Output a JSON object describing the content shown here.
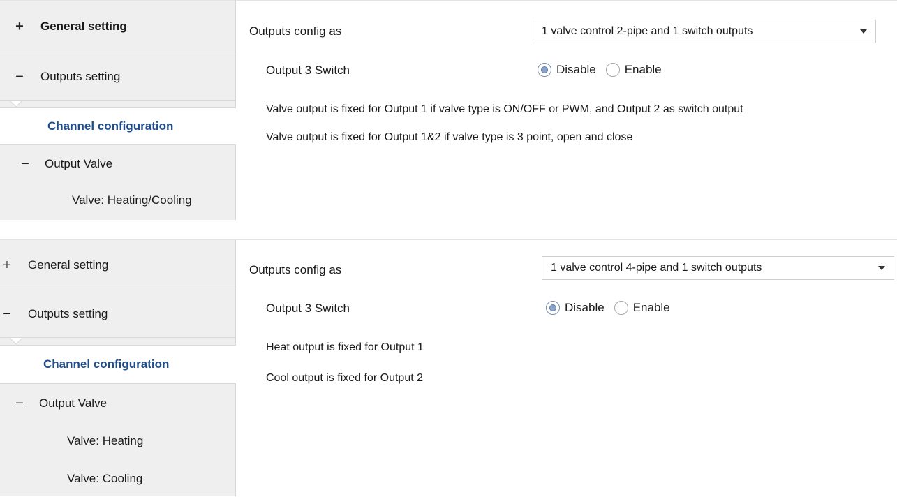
{
  "panel1": {
    "sidebar": {
      "general_sign": "+",
      "general_label": "General setting",
      "outputs_sign": "−",
      "outputs_label": "Outputs setting",
      "channel_label": "Channel configuration",
      "valve_sign": "−",
      "valve_label": "Output Valve",
      "sub_items": [
        "Valve: Heating/Cooling"
      ]
    },
    "main": {
      "config_label": "Outputs config as",
      "config_value": "1 valve control 2-pipe and 1 switch outputs",
      "switch_label": "Output 3 Switch",
      "radio_disable": "Disable",
      "radio_enable": "Enable",
      "selected": "Disable",
      "notes": [
        "Valve output is fixed for Output 1 if  valve type is ON/OFF or PWM, and Output 2 as switch output",
        "Valve output is fixed for Output 1&2 if  valve type is 3 point, open and close"
      ]
    }
  },
  "panel2": {
    "sidebar": {
      "general_sign": "+",
      "general_label": "General setting",
      "outputs_sign": "−",
      "outputs_label": "Outputs setting",
      "channel_label": "Channel configuration",
      "valve_sign": "−",
      "valve_label": "Output Valve",
      "sub_items": [
        "Valve: Heating",
        "Valve: Cooling"
      ]
    },
    "main": {
      "config_label": "Outputs config as",
      "config_value": "1 valve control 4-pipe and 1 switch outputs",
      "switch_label": "Output 3 Switch",
      "radio_disable": "Disable",
      "radio_enable": "Enable",
      "selected": "Disable",
      "notes": [
        "Heat output is fixed for Output 1",
        "Cool output is fixed for Output 2"
      ]
    }
  },
  "colors": {
    "sidebar_bg": "#efefef",
    "active_text": "#1f4e8c",
    "radio_fill": "#8aa4c8"
  },
  "icons": {
    "expand": "plus-icon",
    "collapse": "minus-icon",
    "dropdown": "chevron-down-icon"
  }
}
